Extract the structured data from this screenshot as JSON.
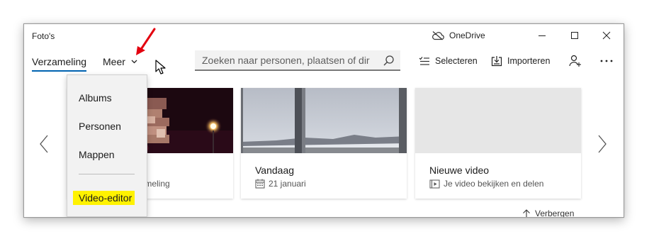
{
  "window": {
    "title": "Foto's",
    "onedrive_label": "OneDrive"
  },
  "nav": {
    "tab_collection": "Verzameling",
    "tab_more": "Meer"
  },
  "search": {
    "placeholder": "Zoeken naar personen, plaatsen of dir"
  },
  "commands": {
    "select_label": "Selecteren",
    "import_label": "Importeren"
  },
  "menu": {
    "items": [
      {
        "label": "Albums"
      },
      {
        "label": "Personen"
      },
      {
        "label": "Mappen"
      }
    ],
    "video_editor": "Video-editor",
    "highlight_color": "#fff200"
  },
  "cards": [
    {
      "title": "",
      "subtitle": "verzameling"
    },
    {
      "title": "Vandaag",
      "subtitle": "21 januari"
    },
    {
      "title": "Nieuwe video",
      "subtitle": "Je video bekijken en delen"
    }
  ],
  "footer": {
    "hide_label": "Verbergen"
  },
  "colors": {
    "accent": "#0063b1",
    "annotation_arrow": "#e3000f"
  }
}
